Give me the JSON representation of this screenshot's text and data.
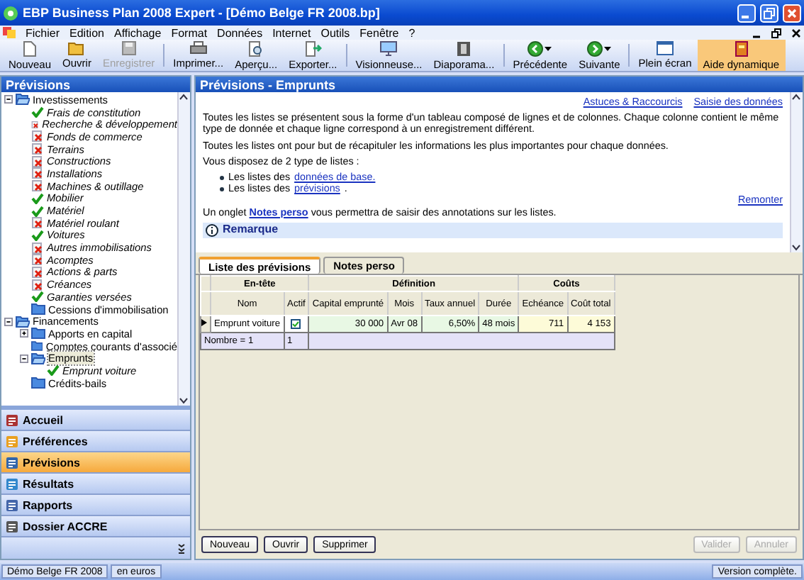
{
  "window": {
    "title": "EBP Business Plan 2008 Expert - [Démo Belge FR 2008.bp]"
  },
  "menu": [
    {
      "label": "Fichier"
    },
    {
      "label": "Edition"
    },
    {
      "label": "Affichage"
    },
    {
      "label": "Format"
    },
    {
      "label": "Données"
    },
    {
      "label": "Internet"
    },
    {
      "label": "Outils"
    },
    {
      "label": "Fenêtre"
    },
    {
      "label": "?"
    }
  ],
  "toolbar": [
    {
      "label": "Nouveau",
      "disabled": false,
      "selected": false,
      "dropdown": false
    },
    {
      "label": "Ouvrir",
      "disabled": false,
      "selected": false,
      "dropdown": false
    },
    {
      "label": "Enregistrer",
      "disabled": true,
      "selected": false,
      "dropdown": false
    },
    {
      "label": "Imprimer...",
      "disabled": false,
      "selected": false,
      "dropdown": false
    },
    {
      "label": "Aperçu...",
      "disabled": false,
      "selected": false,
      "dropdown": false
    },
    {
      "label": "Exporter...",
      "disabled": false,
      "selected": false,
      "dropdown": false
    },
    {
      "label": "Visionneuse...",
      "disabled": false,
      "selected": false,
      "dropdown": false
    },
    {
      "label": "Diaporama...",
      "disabled": false,
      "selected": false,
      "dropdown": false
    },
    {
      "label": "Précédente",
      "disabled": false,
      "selected": false,
      "dropdown": true
    },
    {
      "label": "Suivante",
      "disabled": false,
      "selected": false,
      "dropdown": true
    },
    {
      "label": "Plein écran",
      "disabled": false,
      "selected": false,
      "dropdown": false
    },
    {
      "label": "Aide dynamique",
      "disabled": false,
      "selected": true,
      "dropdown": false
    }
  ],
  "sidebar": {
    "title": "Prévisions",
    "tree": [
      {
        "label": "Investissements",
        "kind": "folder",
        "expanded": true,
        "selected": false,
        "children": [
          {
            "label": "Frais de constitution",
            "kind": "check",
            "selected": false
          },
          {
            "label": "Recherche & développement",
            "kind": "cross",
            "selected": false
          },
          {
            "label": "Fonds de commerce",
            "kind": "cross",
            "selected": false
          },
          {
            "label": "Terrains",
            "kind": "cross",
            "selected": false
          },
          {
            "label": "Constructions",
            "kind": "cross",
            "selected": false
          },
          {
            "label": "Installations",
            "kind": "cross",
            "selected": false
          },
          {
            "label": "Machines & outillage",
            "kind": "cross",
            "selected": false
          },
          {
            "label": "Mobilier",
            "kind": "check",
            "selected": false
          },
          {
            "label": "Matériel",
            "kind": "check",
            "selected": false
          },
          {
            "label": "Matériel roulant",
            "kind": "cross",
            "selected": false
          },
          {
            "label": "Voitures",
            "kind": "check",
            "selected": false
          },
          {
            "label": "Autres immobilisations",
            "kind": "cross",
            "selected": false
          },
          {
            "label": "Acomptes",
            "kind": "cross",
            "selected": false
          },
          {
            "label": "Actions & parts",
            "kind": "cross",
            "selected": false
          },
          {
            "label": "Créances",
            "kind": "cross",
            "selected": false
          },
          {
            "label": "Garanties versées",
            "kind": "check",
            "selected": false
          },
          {
            "label": "Cessions d'immobilisation",
            "kind": "folder",
            "selected": false
          }
        ]
      },
      {
        "label": "Financements",
        "kind": "folder",
        "expanded": true,
        "selected": false,
        "children": [
          {
            "label": "Apports en capital",
            "kind": "folder",
            "expanded": false,
            "selected": false
          },
          {
            "label": "Comptes courants d'associé",
            "kind": "folder",
            "selected": false
          },
          {
            "label": "Emprunts",
            "kind": "folder",
            "expanded": true,
            "selected": true,
            "children": [
              {
                "label": "Emprunt voiture",
                "kind": "check",
                "selected": false
              }
            ]
          },
          {
            "label": "Crédits-bails",
            "kind": "folder",
            "selected": false
          }
        ]
      }
    ],
    "nav": [
      {
        "label": "Accueil",
        "selected": false
      },
      {
        "label": "Préférences",
        "selected": false
      },
      {
        "label": "Prévisions",
        "selected": true
      },
      {
        "label": "Résultats",
        "selected": false
      },
      {
        "label": "Rapports",
        "selected": false
      },
      {
        "label": "Dossier ACCRE",
        "selected": false
      }
    ]
  },
  "content": {
    "title": "Prévisions - Emprunts",
    "top_links": [
      "Astuces & Raccourcis",
      "Saisie des données"
    ],
    "paragraphs": [
      [
        {
          "kind": "text",
          "text": "Toutes les listes se présentent sous la forme d'un tableau composé de lignes et de colonnes. Chaque colonne contient le même type de donnée et chaque ligne correspond à un enregistrement différent."
        }
      ],
      [
        {
          "kind": "text",
          "text": "Toutes les listes ont pour but de récapituler les informations les plus importantes pour chaque données."
        }
      ],
      [
        {
          "kind": "text",
          "text": "Vous disposez de 2 type de listes :"
        }
      ]
    ],
    "bullets": [
      [
        {
          "kind": "text",
          "text": "Les listes des"
        },
        {
          "kind": "link",
          "text": "données de base."
        }
      ],
      [
        {
          "kind": "text",
          "text": "Les listes des"
        },
        {
          "kind": "link",
          "text": "prévisions"
        },
        {
          "kind": "text",
          "text": "."
        }
      ]
    ],
    "back_link": "Remonter",
    "note": [
      {
        "kind": "text",
        "text": "Un onglet"
      },
      {
        "kind": "bold_link",
        "text": "Notes perso"
      },
      {
        "kind": "text",
        "text": "vous permettra de saisir des annotations sur les listes."
      }
    ],
    "remark_title": "Remarque",
    "tabs": [
      {
        "label": "Liste des prévisions",
        "selected": true
      },
      {
        "label": "Notes perso",
        "selected": false
      }
    ],
    "table": {
      "groups": [
        {
          "label": "En-tête",
          "columns": [
            "Nom",
            "Actif"
          ]
        },
        {
          "label": "Définition",
          "columns": [
            "Capital emprunté",
            "Mois",
            "Taux annuel",
            "Durée"
          ]
        },
        {
          "label": "Coûts",
          "columns": [
            "Echéance",
            "Coût total"
          ]
        }
      ],
      "rows": [
        {
          "cells": [
            "Emprunt voiture",
            null,
            "30 000",
            "Avr 08",
            "6,50%",
            "48 mois",
            "711",
            "4 153"
          ],
          "active": true,
          "current": true
        }
      ],
      "footer": [
        "Nombre = 1",
        "1"
      ]
    },
    "buttons": [
      {
        "label": "Nouveau",
        "disabled": false
      },
      {
        "label": "Ouvrir",
        "disabled": false
      },
      {
        "label": "Supprimer",
        "disabled": false
      }
    ],
    "dialog_buttons": [
      {
        "label": "Valider",
        "disabled": true
      },
      {
        "label": "Annuler",
        "disabled": true
      }
    ]
  },
  "status_bar": {
    "file": "Démo Belge FR 2008",
    "currency": "en euros",
    "version": "Version complète."
  }
}
